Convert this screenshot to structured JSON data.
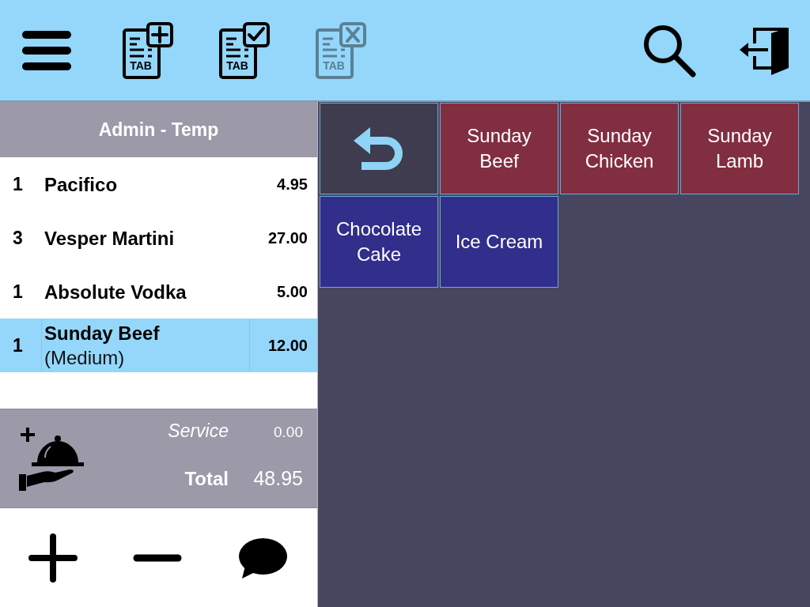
{
  "toolbar": {
    "left_buttons": [
      {
        "kind": "menu",
        "disabled": false
      },
      {
        "kind": "tab-new",
        "icon_text": "TAB",
        "disabled": false
      },
      {
        "kind": "tab-confirm",
        "icon_text": "TAB",
        "disabled": false
      },
      {
        "kind": "tab-cancel",
        "icon_text": "TAB",
        "disabled": true
      }
    ],
    "right_buttons": [
      {
        "kind": "search"
      },
      {
        "kind": "exit"
      }
    ]
  },
  "order": {
    "title": "Admin - Temp",
    "items": [
      {
        "qty": "1",
        "name": "Pacifico",
        "price": "4.95",
        "selected": false
      },
      {
        "qty": "3",
        "name": "Vesper Martini",
        "price": "27.00",
        "selected": false
      },
      {
        "qty": "1",
        "name": "Absolute Vodka",
        "price": "5.00",
        "selected": false
      },
      {
        "qty": "1",
        "name": "Sunday Beef",
        "modifier": "(Medium)",
        "price": "12.00",
        "selected": true
      }
    ]
  },
  "totals": {
    "service_label": "Service",
    "service": "0.00",
    "total_label": "Total",
    "total": "48.95"
  },
  "actions": [
    {
      "kind": "add"
    },
    {
      "kind": "remove"
    },
    {
      "kind": "note"
    }
  ],
  "tiles": [
    {
      "kind": "back"
    },
    {
      "kind": "item",
      "label": "Sunday Beef",
      "color": "#822e41"
    },
    {
      "kind": "item",
      "label": "Sunday Chicken",
      "color": "#822e41"
    },
    {
      "kind": "item",
      "label": "Sunday Lamb",
      "color": "#822e41"
    },
    {
      "kind": "item",
      "label": "Chocolate Cake",
      "color": "#312e8c"
    },
    {
      "kind": "item",
      "label": "Ice Cream",
      "color": "#312e8c"
    }
  ]
}
